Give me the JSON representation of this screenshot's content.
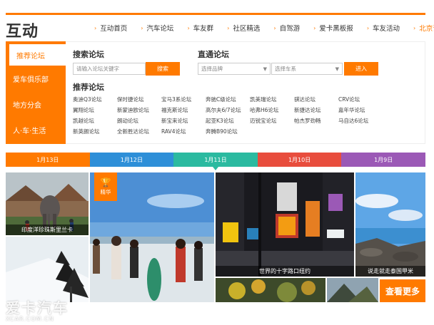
{
  "header": {
    "brand": "互动",
    "nav": [
      {
        "label": "互动首页",
        "active": false
      },
      {
        "label": "汽车论坛",
        "active": false
      },
      {
        "label": "车友群",
        "active": false
      },
      {
        "label": "社区精选",
        "active": false
      },
      {
        "label": "自驾游",
        "active": false
      },
      {
        "label": "爱卡黑板报",
        "active": false
      },
      {
        "label": "车友活动",
        "active": false
      },
      {
        "label": "北京论坛",
        "active": true
      }
    ]
  },
  "sidebar": {
    "items": [
      {
        "label": "推荐论坛",
        "active": true
      },
      {
        "label": "爱车俱乐部",
        "active": false
      },
      {
        "label": "地方分会",
        "active": false
      },
      {
        "label": "人·车·生活",
        "active": false
      }
    ]
  },
  "search": {
    "title": "搜索论坛",
    "placeholder": "请输入论坛关键字",
    "button": "搜索"
  },
  "direct": {
    "title": "直通论坛",
    "brand_placeholder": "选择品牌",
    "series_placeholder": "选择车系",
    "button": "进入"
  },
  "recommended": {
    "title": "推荐论坛",
    "forums": [
      "奥迪Q3论坛",
      "保时捷论坛",
      "宝马3系论坛",
      "奔驰C级论坛",
      "凯美瑞论坛",
      "骐达论坛",
      "CRV论坛",
      "翼翔论坛",
      "新蒙迪欧论坛",
      "福克斯论坛",
      "高尔夫6/7论坛",
      "哈弗H6论坛",
      "新捷达论坛",
      "嘉年华论坛",
      "凯越论坛",
      "朗动论坛",
      "新宝来论坛",
      "起亚K3论坛",
      "迈锐宝论坛",
      "帕杰罗劲畅",
      "马自达6论坛",
      "新英朗论坛",
      "全新胜达论坛",
      "RAV4论坛",
      "奔腾B90论坛"
    ]
  },
  "date_tabs": [
    {
      "label": "1月13日",
      "color": "#ff7a00",
      "active": false
    },
    {
      "label": "1月12日",
      "color": "#2e8fd8",
      "active": false
    },
    {
      "label": "1月11日",
      "color": "#2bbaa0",
      "active": true
    },
    {
      "label": "1月10日",
      "color": "#e84d3d",
      "active": false
    },
    {
      "label": "1月9日",
      "color": "#9b59b6",
      "active": false
    }
  ],
  "photos": {
    "p1_caption": "印度洋珍珠斯里兰卡",
    "badge": "精华",
    "p4_caption": "世界的十字路口纽约",
    "p5_caption": "说走就走泰国甲米",
    "more": "查看更多"
  },
  "watermark": {
    "line1": "爱卡汽车",
    "line2": "XCAR.COM.CN"
  }
}
